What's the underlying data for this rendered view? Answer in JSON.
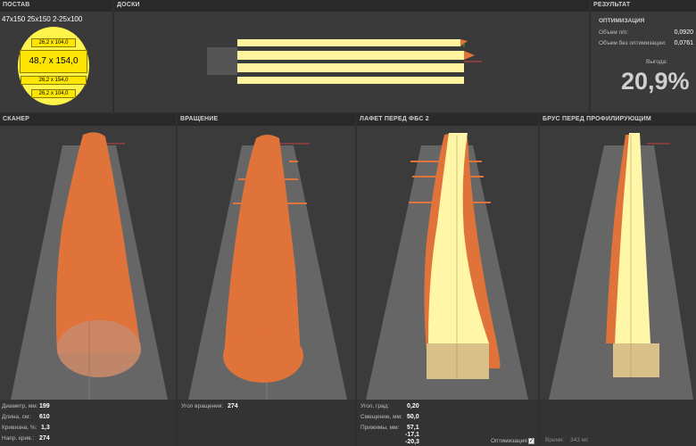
{
  "postav": {
    "header": "ПОСТАВ",
    "scheme": "47x150 25x150 2-25x100",
    "boards": [
      "26,2 x 104,0",
      "48,7 x 154,0",
      "26,2 x 154,0",
      "26,2 x 104,0"
    ]
  },
  "doski": {
    "header": "ДОСКИ"
  },
  "result": {
    "header": "РЕЗУЛЬТАТ",
    "section": "ОПТИМИЗАЦИЯ",
    "volume_label": "Объем п/п:",
    "volume_value": "0,0920",
    "volume_noopt_label": "Объем без оптимизации:",
    "volume_noopt_value": "0,0761",
    "gain_label": "Выгода:",
    "gain_value": "20,9%"
  },
  "scanner": {
    "header": "СКАНЕР",
    "diameter_label": "Диаметр, мм:",
    "diameter_value": "199",
    "length_label": "Длина, см:",
    "length_value": "610",
    "curvature_label": "Кривизна, %:",
    "curvature_value": "1,3",
    "curvdir_label": "Напр. крив.:",
    "curvdir_value": "274"
  },
  "rotation": {
    "header": "ВРАЩЕНИЕ",
    "angle_label": "Угол вращения:",
    "angle_value": "274"
  },
  "carriage": {
    "header": "ЛАФЕТ ПЕРЕД ФБС 2",
    "angle_label": "Угол, град:",
    "angle_value": "0,20",
    "shift_label": "Смещение, мм:",
    "shift_value": "50,0",
    "clamp_label": "Прижимы, мм:",
    "clamp_values": [
      "57,1",
      "-17,1",
      "-20,3"
    ],
    "optimization_label": "Оптимизация",
    "optimization_checked": "✓"
  },
  "beam": {
    "header": "БРУС ПЕРЕД ПРОФИЛИРУЮЩИМ",
    "time_label": "Время:",
    "time_value": "343 мс"
  },
  "colors": {
    "log": "#e0733a",
    "wood": "#fff3a0",
    "conveyor": "#666666"
  }
}
